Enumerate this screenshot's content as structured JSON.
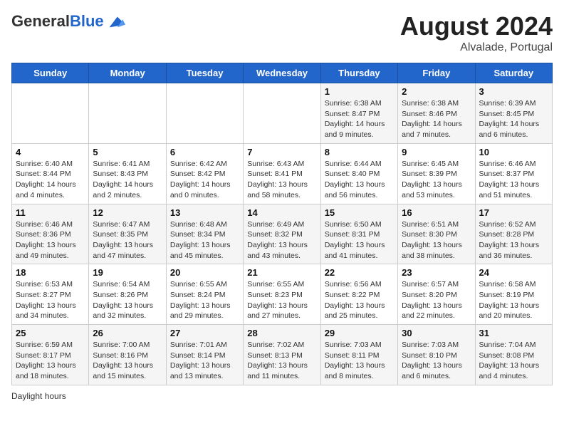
{
  "header": {
    "logo_general": "General",
    "logo_blue": "Blue",
    "month_title": "August 2024",
    "location": "Alvalade, Portugal"
  },
  "weekdays": [
    "Sunday",
    "Monday",
    "Tuesday",
    "Wednesday",
    "Thursday",
    "Friday",
    "Saturday"
  ],
  "footer": {
    "daylight_label": "Daylight hours"
  },
  "weeks": [
    [
      {
        "day": "",
        "info": ""
      },
      {
        "day": "",
        "info": ""
      },
      {
        "day": "",
        "info": ""
      },
      {
        "day": "",
        "info": ""
      },
      {
        "day": "1",
        "info": "Sunrise: 6:38 AM\nSunset: 8:47 PM\nDaylight: 14 hours\nand 9 minutes."
      },
      {
        "day": "2",
        "info": "Sunrise: 6:38 AM\nSunset: 8:46 PM\nDaylight: 14 hours\nand 7 minutes."
      },
      {
        "day": "3",
        "info": "Sunrise: 6:39 AM\nSunset: 8:45 PM\nDaylight: 14 hours\nand 6 minutes."
      }
    ],
    [
      {
        "day": "4",
        "info": "Sunrise: 6:40 AM\nSunset: 8:44 PM\nDaylight: 14 hours\nand 4 minutes."
      },
      {
        "day": "5",
        "info": "Sunrise: 6:41 AM\nSunset: 8:43 PM\nDaylight: 14 hours\nand 2 minutes."
      },
      {
        "day": "6",
        "info": "Sunrise: 6:42 AM\nSunset: 8:42 PM\nDaylight: 14 hours\nand 0 minutes."
      },
      {
        "day": "7",
        "info": "Sunrise: 6:43 AM\nSunset: 8:41 PM\nDaylight: 13 hours\nand 58 minutes."
      },
      {
        "day": "8",
        "info": "Sunrise: 6:44 AM\nSunset: 8:40 PM\nDaylight: 13 hours\nand 56 minutes."
      },
      {
        "day": "9",
        "info": "Sunrise: 6:45 AM\nSunset: 8:39 PM\nDaylight: 13 hours\nand 53 minutes."
      },
      {
        "day": "10",
        "info": "Sunrise: 6:46 AM\nSunset: 8:37 PM\nDaylight: 13 hours\nand 51 minutes."
      }
    ],
    [
      {
        "day": "11",
        "info": "Sunrise: 6:46 AM\nSunset: 8:36 PM\nDaylight: 13 hours\nand 49 minutes."
      },
      {
        "day": "12",
        "info": "Sunrise: 6:47 AM\nSunset: 8:35 PM\nDaylight: 13 hours\nand 47 minutes."
      },
      {
        "day": "13",
        "info": "Sunrise: 6:48 AM\nSunset: 8:34 PM\nDaylight: 13 hours\nand 45 minutes."
      },
      {
        "day": "14",
        "info": "Sunrise: 6:49 AM\nSunset: 8:32 PM\nDaylight: 13 hours\nand 43 minutes."
      },
      {
        "day": "15",
        "info": "Sunrise: 6:50 AM\nSunset: 8:31 PM\nDaylight: 13 hours\nand 41 minutes."
      },
      {
        "day": "16",
        "info": "Sunrise: 6:51 AM\nSunset: 8:30 PM\nDaylight: 13 hours\nand 38 minutes."
      },
      {
        "day": "17",
        "info": "Sunrise: 6:52 AM\nSunset: 8:28 PM\nDaylight: 13 hours\nand 36 minutes."
      }
    ],
    [
      {
        "day": "18",
        "info": "Sunrise: 6:53 AM\nSunset: 8:27 PM\nDaylight: 13 hours\nand 34 minutes."
      },
      {
        "day": "19",
        "info": "Sunrise: 6:54 AM\nSunset: 8:26 PM\nDaylight: 13 hours\nand 32 minutes."
      },
      {
        "day": "20",
        "info": "Sunrise: 6:55 AM\nSunset: 8:24 PM\nDaylight: 13 hours\nand 29 minutes."
      },
      {
        "day": "21",
        "info": "Sunrise: 6:55 AM\nSunset: 8:23 PM\nDaylight: 13 hours\nand 27 minutes."
      },
      {
        "day": "22",
        "info": "Sunrise: 6:56 AM\nSunset: 8:22 PM\nDaylight: 13 hours\nand 25 minutes."
      },
      {
        "day": "23",
        "info": "Sunrise: 6:57 AM\nSunset: 8:20 PM\nDaylight: 13 hours\nand 22 minutes."
      },
      {
        "day": "24",
        "info": "Sunrise: 6:58 AM\nSunset: 8:19 PM\nDaylight: 13 hours\nand 20 minutes."
      }
    ],
    [
      {
        "day": "25",
        "info": "Sunrise: 6:59 AM\nSunset: 8:17 PM\nDaylight: 13 hours\nand 18 minutes."
      },
      {
        "day": "26",
        "info": "Sunrise: 7:00 AM\nSunset: 8:16 PM\nDaylight: 13 hours\nand 15 minutes."
      },
      {
        "day": "27",
        "info": "Sunrise: 7:01 AM\nSunset: 8:14 PM\nDaylight: 13 hours\nand 13 minutes."
      },
      {
        "day": "28",
        "info": "Sunrise: 7:02 AM\nSunset: 8:13 PM\nDaylight: 13 hours\nand 11 minutes."
      },
      {
        "day": "29",
        "info": "Sunrise: 7:03 AM\nSunset: 8:11 PM\nDaylight: 13 hours\nand 8 minutes."
      },
      {
        "day": "30",
        "info": "Sunrise: 7:03 AM\nSunset: 8:10 PM\nDaylight: 13 hours\nand 6 minutes."
      },
      {
        "day": "31",
        "info": "Sunrise: 7:04 AM\nSunset: 8:08 PM\nDaylight: 13 hours\nand 4 minutes."
      }
    ]
  ]
}
